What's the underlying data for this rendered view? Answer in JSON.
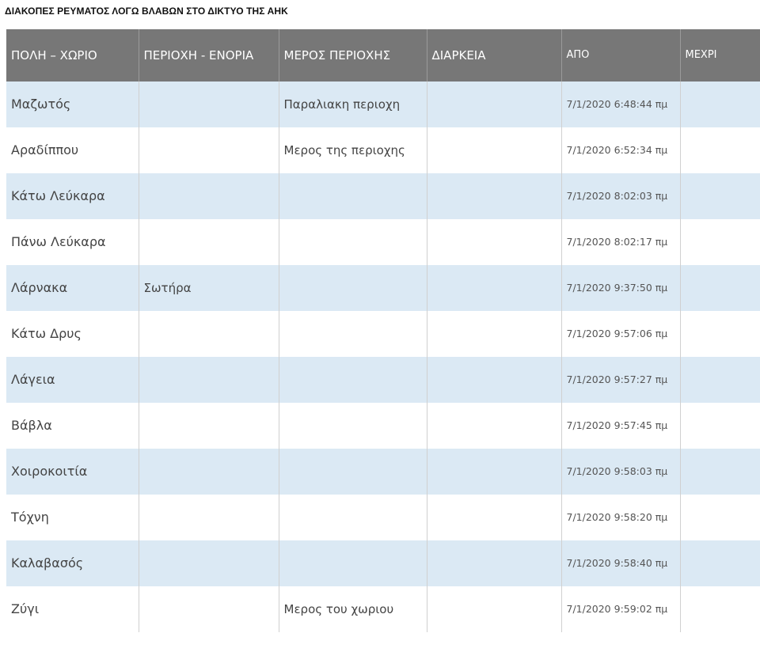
{
  "title": "ΔΙΑΚΟΠΕΣ ΡΕΥΜΑΤΟΣ ΛΟΓΩ ΒΛΑΒΩΝ ΣΤΟ ΔΙΚΤΥΟ ΤΗΣ ΑΗΚ",
  "columns": {
    "city": "ΠΟΛΗ – ΧΩΡΙΟ",
    "area": "ΠΕΡΙΟΧΗ - ΕΝΟΡΙΑ",
    "part": "ΜΕΡΟΣ ΠΕΡΙΟΧΗΣ",
    "duration": "ΔΙΑΡΚΕΙΑ",
    "from": "ΑΠΟ",
    "until": "ΜΕΧΡΙ"
  },
  "rows": [
    {
      "city": "Μαζωτός",
      "area": "",
      "part": "Παραλιακη περιοχη",
      "duration": "",
      "from": "7/1/2020 6:48:44 πμ",
      "until": ""
    },
    {
      "city": "Αραδίππου",
      "area": "",
      "part": "Μερος της περιοχης",
      "duration": "",
      "from": "7/1/2020 6:52:34 πμ",
      "until": ""
    },
    {
      "city": "Κάτω Λεύκαρα",
      "area": "",
      "part": "",
      "duration": "",
      "from": "7/1/2020 8:02:03 πμ",
      "until": ""
    },
    {
      "city": "Πάνω Λεύκαρα",
      "area": "",
      "part": "",
      "duration": "",
      "from": "7/1/2020 8:02:17 πμ",
      "until": ""
    },
    {
      "city": "Λάρνακα",
      "area": "Σωτήρα",
      "part": "",
      "duration": "",
      "from": "7/1/2020 9:37:50 πμ",
      "until": ""
    },
    {
      "city": "Κάτω Δρυς",
      "area": "",
      "part": "",
      "duration": "",
      "from": "7/1/2020 9:57:06 πμ",
      "until": ""
    },
    {
      "city": "Λάγεια",
      "area": "",
      "part": "",
      "duration": "",
      "from": "7/1/2020 9:57:27 πμ",
      "until": ""
    },
    {
      "city": "Βάβλα",
      "area": "",
      "part": "",
      "duration": "",
      "from": "7/1/2020 9:57:45 πμ",
      "until": ""
    },
    {
      "city": "Χοιροκοιτία",
      "area": "",
      "part": "",
      "duration": "",
      "from": "7/1/2020 9:58:03 πμ",
      "until": ""
    },
    {
      "city": "Τόχνη",
      "area": "",
      "part": "",
      "duration": "",
      "from": "7/1/2020 9:58:20 πμ",
      "until": ""
    },
    {
      "city": "Καλαβασός",
      "area": "",
      "part": "",
      "duration": "",
      "from": "7/1/2020 9:58:40 πμ",
      "until": ""
    },
    {
      "city": "Ζύγι",
      "area": "",
      "part": "Μερος του χωριου",
      "duration": "",
      "from": "7/1/2020 9:59:02 πμ",
      "until": ""
    }
  ]
}
